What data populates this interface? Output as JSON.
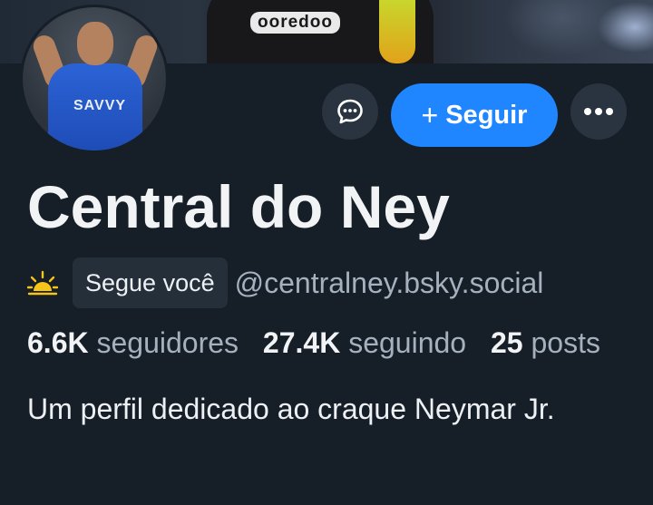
{
  "banner": {
    "sponsor_text": "ooredoo"
  },
  "avatar": {
    "shirt_text": "SAVVY"
  },
  "actions": {
    "message_icon": "chat-bubble-icon",
    "follow_plus": "+",
    "follow_label": "Seguir",
    "more_icon": "ellipsis-icon",
    "follow_color": "#1f86ff"
  },
  "profile": {
    "display_name": "Central do Ney",
    "status_icon": "sun-icon",
    "follows_you": "Segue você",
    "handle": "@centralney.bsky.social",
    "bio": "Um perfil dedicado ao craque Neymar Jr."
  },
  "stats": {
    "followers_count": "6.6K",
    "followers_label": "seguidores",
    "following_count": "27.4K",
    "following_label": "seguindo",
    "posts_count": "25",
    "posts_label": "posts"
  }
}
